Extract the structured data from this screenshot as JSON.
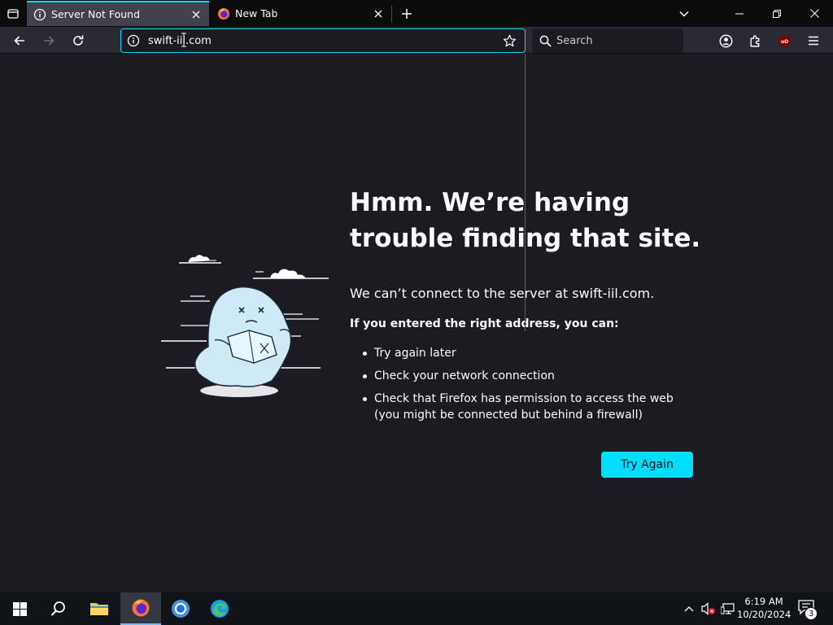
{
  "tabs": [
    {
      "title": "Server Not Found",
      "icon": "info-icon",
      "active": true
    },
    {
      "title": "New Tab",
      "icon": "firefox-icon",
      "active": false
    }
  ],
  "urlbar": {
    "value": "swift-iil.com"
  },
  "searchbar": {
    "placeholder": "Search"
  },
  "error": {
    "title": "Hmm. We’re having trouble finding that site.",
    "description": "We can’t connect to the server at swift-iil.com.",
    "subtitle": "If you entered the right address, you can:",
    "suggestions": [
      "Try again later",
      "Check your network connection",
      "Check that Firefox has permission to access the web (you might be connected but behind a firewall)"
    ],
    "button": "Try Again"
  },
  "taskbar": {
    "time": "6:19 AM",
    "date": "10/20/2024",
    "notification_count": "3"
  },
  "colors": {
    "accent": "#00ddff",
    "page_bg": "#1c1b22",
    "toolbar_bg": "#2b2a33",
    "tabstrip_bg": "#0c0c0d"
  }
}
